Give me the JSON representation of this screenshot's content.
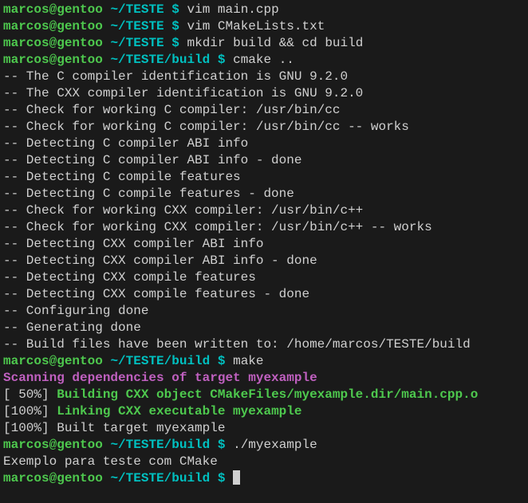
{
  "prompts": [
    {
      "userhost": "marcos@gentoo",
      "path": "~/TESTE",
      "sym": "$",
      "cmd": "vim main.cpp"
    },
    {
      "userhost": "marcos@gentoo",
      "path": "~/TESTE",
      "sym": "$",
      "cmd": "vim CMakeLists.txt"
    },
    {
      "userhost": "marcos@gentoo",
      "path": "~/TESTE",
      "sym": "$",
      "cmd": "mkdir build && cd build"
    },
    {
      "userhost": "marcos@gentoo",
      "path": "~/TESTE/build",
      "sym": "$",
      "cmd": "cmake .."
    }
  ],
  "cmake_output": [
    "-- The C compiler identification is GNU 9.2.0",
    "-- The CXX compiler identification is GNU 9.2.0",
    "-- Check for working C compiler: /usr/bin/cc",
    "-- Check for working C compiler: /usr/bin/cc -- works",
    "-- Detecting C compiler ABI info",
    "-- Detecting C compiler ABI info - done",
    "-- Detecting C compile features",
    "-- Detecting C compile features - done",
    "-- Check for working CXX compiler: /usr/bin/c++",
    "-- Check for working CXX compiler: /usr/bin/c++ -- works",
    "-- Detecting CXX compiler ABI info",
    "-- Detecting CXX compiler ABI info - done",
    "-- Detecting CXX compile features",
    "-- Detecting CXX compile features - done",
    "-- Configuring done",
    "-- Generating done",
    "-- Build files have been written to: /home/marcos/TESTE/build"
  ],
  "prompt_make": {
    "userhost": "marcos@gentoo",
    "path": "~/TESTE/build",
    "sym": "$",
    "cmd": "make"
  },
  "make_scan": "Scanning dependencies of target myexample",
  "make_build_pct": "[ 50%] ",
  "make_build_msg": "Building CXX object CMakeFiles/myexample.dir/main.cpp.o",
  "make_link_pct": "[100%] ",
  "make_link_msg": "Linking CXX executable myexample",
  "make_done": "[100%] Built target myexample",
  "prompt_run": {
    "userhost": "marcos@gentoo",
    "path": "~/TESTE/build",
    "sym": "$",
    "cmd": "./myexample"
  },
  "run_output": "Exemplo para teste com CMake",
  "prompt_final": {
    "userhost": "marcos@gentoo",
    "path": "~/TESTE/build",
    "sym": "$",
    "cmd": ""
  }
}
